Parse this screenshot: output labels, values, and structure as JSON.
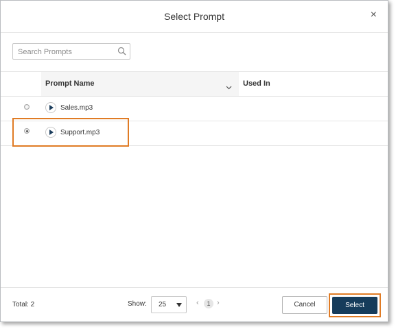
{
  "dialog": {
    "title": "Select Prompt",
    "close_glyph": "×"
  },
  "search": {
    "placeholder": "Search Prompts",
    "value": ""
  },
  "table": {
    "columns": [
      "Prompt Name",
      "Used In"
    ],
    "rows": [
      {
        "name": "Sales.mp3",
        "selected": false
      },
      {
        "name": "Support.mp3",
        "selected": true
      }
    ]
  },
  "footer": {
    "total_label": "Total: 2",
    "show_label": "Show:",
    "page_size": "25",
    "prev_glyph": "‹",
    "page": "1",
    "next_glyph": "›",
    "cancel_label": "Cancel",
    "select_label": "Select"
  },
  "colors": {
    "accent": "#163c5b",
    "highlight": "#e07b24"
  },
  "icons": [
    "close-icon",
    "search-icon",
    "chevron-down-icon",
    "play-icon",
    "caret-down-icon"
  ]
}
